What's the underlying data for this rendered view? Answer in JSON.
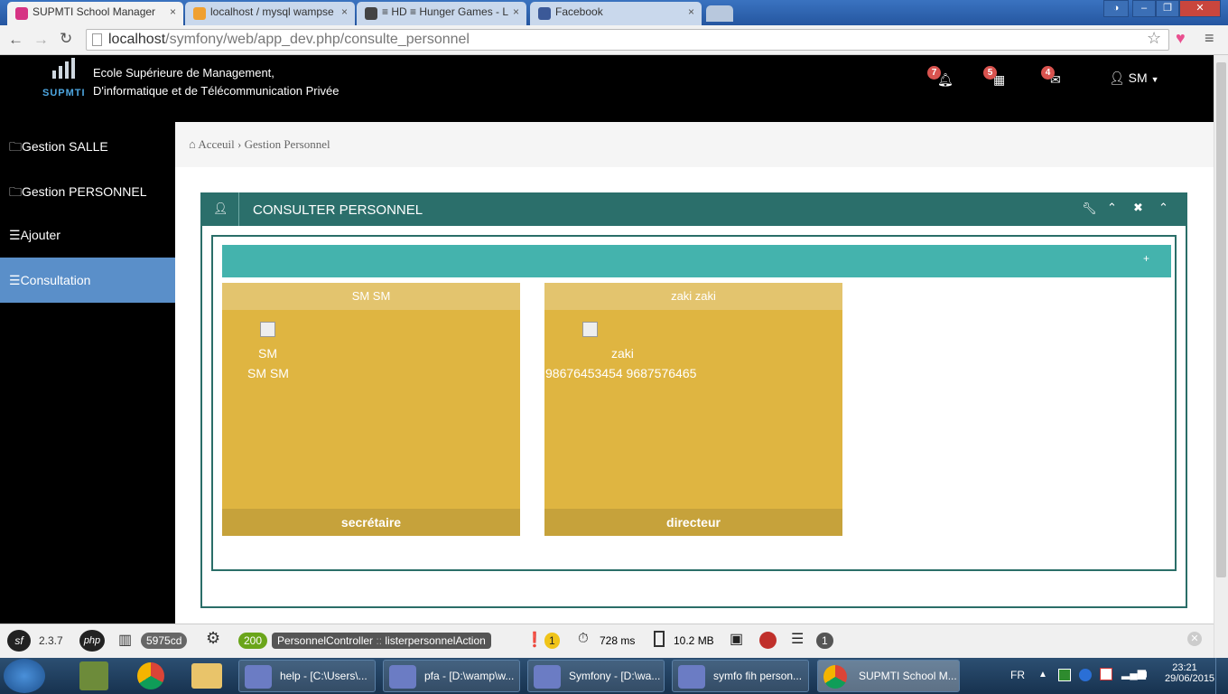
{
  "browser": {
    "tabs": [
      {
        "label": "SUPMTI School Manager",
        "close": "×"
      },
      {
        "label": "localhost / mysql wampse",
        "close": "×"
      },
      {
        "label": "≡ HD ≡ Hunger Games - L",
        "close": "×"
      },
      {
        "label": "Facebook",
        "close": "×"
      }
    ],
    "url_host": "localhost",
    "url_path": "/symfony/web/app_dev.php/consulte_personnel"
  },
  "header": {
    "logo_text": "SUPMTI",
    "school_line1": "Ecole Supérieure de Management,",
    "school_line2": "D'informatique et de Télécommunication Privée",
    "notifications_count": "7",
    "calendar_count": "5",
    "messages_count": "4",
    "user": "SM"
  },
  "sidebar": {
    "items": [
      {
        "label": "Gestion SALLE"
      },
      {
        "label": "Gestion PERSONNEL"
      },
      {
        "label": "Ajouter"
      },
      {
        "label": "Consultation"
      }
    ]
  },
  "breadcrumb": {
    "home": "Acceuil",
    "separator": "›",
    "current": "Gestion Personnel"
  },
  "panel": {
    "title": "CONSULTER PERSONNEL",
    "add": "+"
  },
  "personnel": [
    {
      "header": "SM SM",
      "line1": "SM",
      "line2": "SM SM",
      "role": "secrétaire"
    },
    {
      "header": "zaki zaki",
      "line1": "zaki",
      "line2": "98676453454 9687576465",
      "role": "directeur"
    }
  ],
  "debug": {
    "version": "2.3.7",
    "token": "5975cd",
    "status": "200",
    "controller": "PersonnelController",
    "sep": "::",
    "action": "listerpersonnelAction",
    "errors": "1",
    "time": "728 ms",
    "memory": "10.2 MB",
    "queries": "1"
  },
  "taskbar": {
    "items": [
      {
        "label": "help - [C:\\Users\\..."
      },
      {
        "label": "pfa - [D:\\wamp\\w..."
      },
      {
        "label": "Symfony - [D:\\wa..."
      },
      {
        "label": "symfo fih person..."
      },
      {
        "label": "SUPMTI School M..."
      }
    ],
    "lang": "FR",
    "time": "23:21",
    "date": "29/06/2015"
  },
  "colors": {
    "teal": "#2b6f6b",
    "teal_light": "#44b3ad",
    "card": "#dfb541",
    "sidebar_active": "#5a8fc9"
  }
}
